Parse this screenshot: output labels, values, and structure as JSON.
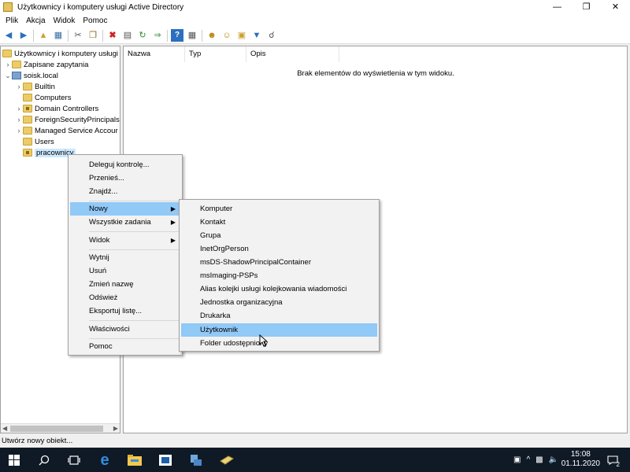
{
  "window": {
    "title": "Użytkownicy i komputery usługi Active Directory"
  },
  "menubar": [
    "Plik",
    "Akcja",
    "Widok",
    "Pomoc"
  ],
  "toolbar_icons": [
    "back-icon",
    "forward-icon",
    "up-folder-icon",
    "show-hide-tree-icon",
    "cut-icon",
    "copy-icon",
    "delete-icon",
    "properties-icon",
    "refresh-icon",
    "export-icon",
    "help-icon",
    "console-icon",
    "new-user-icon",
    "new-group-icon",
    "new-ou-icon",
    "filter-icon",
    "find-icon"
  ],
  "tree": {
    "root": "Użytkownicy i komputery usługi",
    "saved_queries": "Zapisane zapytania",
    "domain": "soisk.local",
    "children": [
      "Builtin",
      "Computers",
      "Domain Controllers",
      "ForeignSecurityPrincipals",
      "Managed Service Accour",
      "Users",
      "pracownicy"
    ]
  },
  "list": {
    "columns": [
      "Nazwa",
      "Typ",
      "Opis"
    ],
    "empty_message": "Brak elementów do wyświetlenia w tym widoku."
  },
  "context_menu": {
    "items": [
      "Deleguj kontrolę...",
      "Przenieś...",
      "Znajdź...",
      "Nowy",
      "Wszystkie zadania",
      "Widok",
      "Wytnij",
      "Usuń",
      "Zmień nazwę",
      "Odśwież",
      "Eksportuj listę...",
      "Właściwości",
      "Pomoc"
    ]
  },
  "submenu": {
    "items": [
      "Komputer",
      "Kontakt",
      "Grupa",
      "InetOrgPerson",
      "msDS-ShadowPrincipalContainer",
      "msImaging-PSPs",
      "Alias kolejki usługi kolejkowania wiadomości",
      "Jednostka organizacyjna",
      "Drukarka",
      "Użytkownik",
      "Folder udostępniony"
    ]
  },
  "statusbar": {
    "text": "Utwórz nowy obiekt..."
  },
  "taskbar": {
    "time": "15:08",
    "date": "01.11.2020",
    "notification_count": "2"
  }
}
